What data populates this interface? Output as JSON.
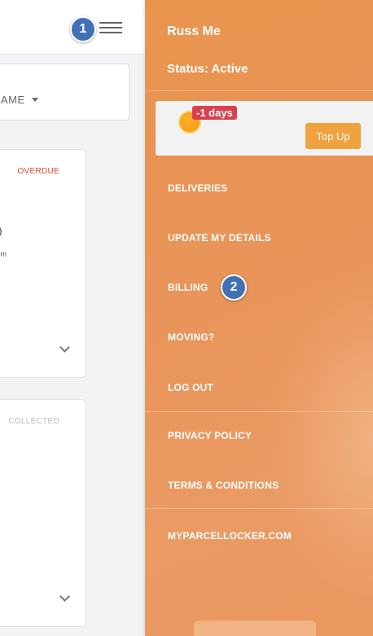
{
  "header": {
    "step_badge_1": "1",
    "menu_icon": "hamburger-icon"
  },
  "sort": {
    "label": "AME",
    "icon": "caret-down-icon"
  },
  "cards": [
    {
      "status": "OVERDUE",
      "line1": "d)",
      "line2": "l pm",
      "expand_icon": "chevron-down-icon"
    },
    {
      "status": "COLLECTED",
      "expand_icon": "chevron-down-icon"
    }
  ],
  "drawer": {
    "user_name": "Russ Me",
    "status": "Status: Active",
    "balance": {
      "coin_icon": "coin-icon",
      "days_label": "-1 days",
      "topup_label": "Top Up"
    },
    "menu": [
      "DELIVERIES",
      "UPDATE MY DETAILS",
      "BILLING",
      "MOVING?",
      "LOG OUT",
      "PRIVACY POLICY",
      "TERMS & CONDITIONS",
      "MYPARCELLOCKER.COM"
    ],
    "step_badge_2": "2"
  },
  "colors": {
    "drawer_orange": "#e9954e",
    "overdue_red": "#e0492a",
    "badge_blue": "#4170b5",
    "days_badge_red": "#d8414f",
    "topup_orange": "#f0a23f"
  }
}
